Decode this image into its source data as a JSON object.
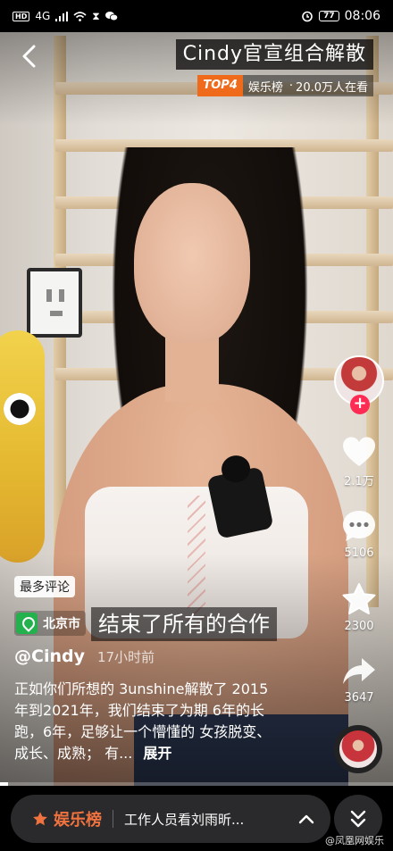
{
  "status_bar": {
    "network": "4G",
    "time": "08:06",
    "battery": "77"
  },
  "header": {
    "title": "Cindy官宣组合解散",
    "rank_badge": "TOP4",
    "hot_category": "娱乐榜",
    "hot_separator": "·",
    "hot_count": "20.0万人在看"
  },
  "actions": {
    "likes": "2.1万",
    "comments": "5106",
    "favorites": "2300",
    "shares": "3647"
  },
  "post": {
    "comments_tag": "最多评论",
    "location": "北京市",
    "subtitle": "结束了所有的合作",
    "author": "@Cindy",
    "time_ago": "17小时前",
    "caption": "正如你们所想的 3unshine解散了 2015年到2021年，我们结束了为期 6年的长跑，6年，足够让一个懵懂的 女孩脱变、成长、成熟；  有...",
    "expand": "展开",
    "progress": 0.02
  },
  "bottom": {
    "hot_list_title": "娱乐榜",
    "hot_list_item": "工作人员看刘雨昕...",
    "watermark": "@凤凰网娱乐"
  },
  "colors": {
    "like_red": "#fe2c55",
    "hot_orange": "#f06a1c",
    "location_green": "#23b14d"
  }
}
